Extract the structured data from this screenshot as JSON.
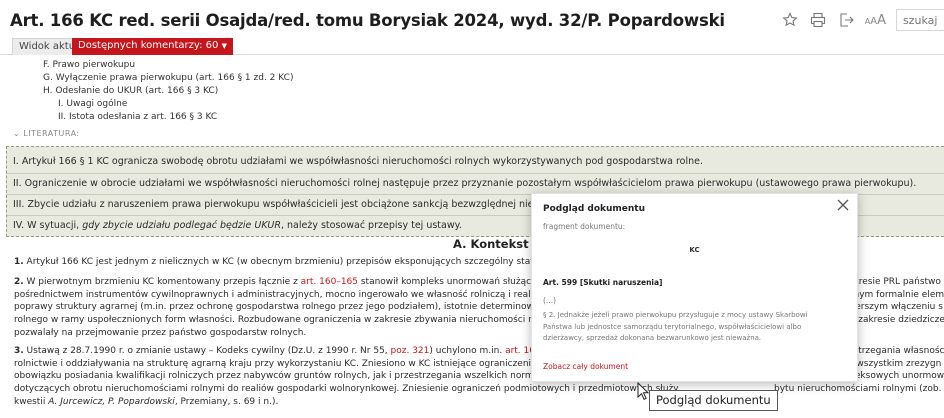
{
  "header": {
    "title": "Art. 166 KC red. serii Osajda/red. tomu Borysiak 2024, wyd. 32/P. Popardowski",
    "font_size_label": "AAA",
    "search_placeholder": "szukaj",
    "icons": [
      "star-icon",
      "print-icon",
      "export-icon"
    ]
  },
  "tabs": {
    "view_label": "Widok aktu",
    "comments_label": "Dostępnych komentarzy: 60"
  },
  "toc": {
    "items": [
      "F. Prawo pierwokupu",
      "G. Wyłączenie prawa pierwokupu (art. 166 § 1 zd. 2 KC)",
      "H. Odesłanie do UKUR (art. 166 § 3 KC)",
      "I. Uwagi ogólne",
      "II. Istota odesłania z art. 166 § 3 KC"
    ],
    "literature_label": "LITERATURA:"
  },
  "summary": {
    "rows": [
      "I. Artykuł 166 § 1 KC ogranicza swobodę obrotu udziałami we współwłasności nieruchomości rolnych wykorzystywanych pod gospodarstwa rolne.",
      "II. Ograniczenie w obrocie udziałami we współwłasności nieruchomości rolnej następuje przez przyznanie pozostałym współwłaścicielom prawa pierwokupu (ustawowego prawa pierwokupu).",
      "III. Zbycie udziału z naruszeniem prawa pierwokupu współwłaścicieli jest obciążone sankcją bezwzględnej nieważności (",
      "IV. W sytuacji, "
    ],
    "row4_italic": "gdy zbycie udziału podlegać będzie UKUR",
    "row4_end": ", należy stosować przepisy tej ustawy."
  },
  "section": {
    "title": "A. Kontekst hi"
  },
  "paragraphs": {
    "p1_num": "1.",
    "p1_text": " Artykuł 166 KC jest jednym z nielicznych w KC (w obecnym brzmieniu) przepisów eksponujących szczególny status nier",
    "p2_num": "2.",
    "p2_a": " W pierwotnym brzmieniu KC komentowany przepis łącznie z ",
    "p2_link": "art. 160–165",
    "p2_b": " stanowił kompleks unormowań służących oc",
    "p2_r1": "okresie PRL państwo",
    "p2_l2": "pośrednictwem instrumentów cywilnoprawnych i administracyjnych, mocno ingerowało we własność rolniczą i realizowa",
    "p2_r2": "anym formalnie elem",
    "p2_l3": "poprawy struktury agrarnej (m.in. przez ochronę gospodarstwa rolnego przez jego podziałem), istotnie determinowana l",
    "p2_r3": "izerszym włączeniu s",
    "p2_l4": "rolnego w ramy uspołecznionych form własności. Rozbudowane ograniczenia w zakresie zbywania nieruchomości rolnej",
    "p2_r4": "w zakresie dziedzicze",
    "p2_l5": "pozwalały na przejmowanie przez państwo gospodarstw rolnych.",
    "p3_num": "3.",
    "p3_a": " Ustawą z 28.7.1990 r. o zmianie ustawy – Kodeks cywilny (Dz.U. z 1990 r. Nr 55, ",
    "p3_link1": "poz. 321",
    "p3_b": ") uchylono m.in. ",
    "p3_link2": "art. 160–165",
    "p3_c": " K",
    "p3_r1": "ostrzegania własnośc",
    "p3_l2": "rolnictwie i oddziaływania na strukturę agrarną kraju przy wykorzystaniu KC. Zniesiono w KC istniejące ograniczenia w sfe",
    "p3_r2": "e wszystkim zrezygn",
    "p3_l3": "obowiązku posiadania kwalifikacji rolniczych przez nabywców gruntów rolnych, jak i przestrzegania wszelkich norm obsza",
    "p3_r3": "dostosowaniu kodeksowych unormow",
    "p3_l4": "dotyczących obrotu nieruchomościami rolnymi do realiów gospodarki wolnorynkowej. Zniesienie ograniczeń podmiotowych i przedmiotowych służy",
    "p3_r4": "bytu nieruchomościami rolnymi (zob. szerz",
    "p3_l5_a": "kwestii ",
    "p3_l5_it": "A. Jurcewicz, P. Popardowski",
    "p3_l5_b": ", Przemiany, s. 69 i n.)."
  },
  "popup": {
    "title": "Podgląd dokumentu",
    "subtitle": "fragment dokumentu:",
    "doc_code": "KC",
    "article": "Art. 599 [Skutki naruszenia]",
    "ellipsis": "(...)",
    "body_lines": [
      "§ 2. Jednakże jeżeli prawo pierwokupu przysługuje z mocy ustawy Skarbowi",
      "Państwa lub jednostce samorządu terytorialnego, współwłaścicielowi albo",
      "dzierżawcy, sprzedaż dokonana bezwarunkowo jest nieważna."
    ],
    "link": "Zobacz cały dokument"
  },
  "tooltip": {
    "text": "Podgląd dokumentu"
  },
  "colors": {
    "accent_red": "#c4161c",
    "summary_bg": "#e9eadf"
  }
}
